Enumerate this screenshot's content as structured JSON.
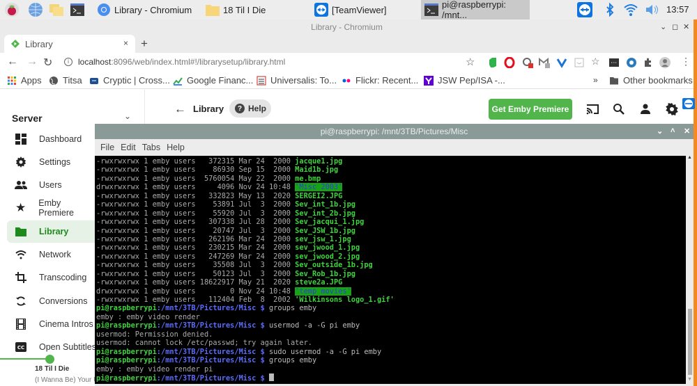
{
  "taskbar": {
    "tasks": [
      {
        "label": "Library - Chromium",
        "icon": "chromium-icon"
      },
      {
        "label": "18 Til I Die",
        "icon": "folder-icon"
      },
      {
        "label": "[TeamViewer]",
        "icon": "teamviewer-icon"
      },
      {
        "label": "pi@raspberrypi: /mnt...",
        "icon": "terminal-icon",
        "active": true
      }
    ],
    "launchers": [
      "raspberry-menu-icon",
      "web-browser-icon",
      "file-manager-icon",
      "terminal-icon"
    ],
    "tray": [
      "teamviewer-icon",
      "bluetooth-icon",
      "wifi-icon",
      "volume-icon"
    ],
    "clock": "13:57"
  },
  "browser": {
    "window_title": "Library - Chromium",
    "tab": {
      "label": "Library",
      "close": "×"
    },
    "new_tab": "+",
    "url_host": "localhost",
    "url_rest": ":8096/web/index.html#!/librarysetup/library.html",
    "bookmarks": [
      {
        "label": "Apps"
      },
      {
        "label": "Titsa"
      },
      {
        "label": "Cryptic | Cross..."
      },
      {
        "label": "Google Financ..."
      },
      {
        "label": "Universalis: To..."
      },
      {
        "label": "Flickr: Recent..."
      },
      {
        "label": "JSW Pep/ISA -..."
      }
    ],
    "bookmarks_overflow": "»",
    "other_bookmarks": "Other bookmarks"
  },
  "emby": {
    "section": "Server",
    "sidebar": [
      {
        "label": "Dashboard",
        "icon": "dashboard-icon"
      },
      {
        "label": "Settings",
        "icon": "gear-icon"
      },
      {
        "label": "Users",
        "icon": "users-icon"
      },
      {
        "label": "Emby Premiere",
        "icon": "star-icon"
      },
      {
        "label": "Library",
        "icon": "folder-icon",
        "active": true
      },
      {
        "label": "Network",
        "icon": "wifi-icon"
      },
      {
        "label": "Transcoding",
        "icon": "crop-icon"
      },
      {
        "label": "Conversions",
        "icon": "sync-icon"
      },
      {
        "label": "Cinema Intros",
        "icon": "film-icon"
      },
      {
        "label": "Open Subtitles",
        "icon": "cc-icon"
      }
    ],
    "page_title": "Library",
    "help_label": "Help",
    "premiere_button": "Get Emby Premiere",
    "accent": "#52b54b",
    "now_playing": {
      "title": "18 Til I Die",
      "artist": "(I Wanna Be) Your Underwear"
    }
  },
  "terminal": {
    "title": "pi@raspberrypi: /mnt/3TB/Pictures/Misc",
    "menu": [
      "File",
      "Edit",
      "Tabs",
      "Help"
    ],
    "listing": [
      {
        "perms": "-rwxrwxrwx 1 emby users   372315 Mar 24  2000 ",
        "name": "jacque1.jpg",
        "dir": false
      },
      {
        "perms": "-rwxrwxrwx 1 emby users    86930 Sep 15  2000 ",
        "name": "Maid1b.jpg",
        "dir": false
      },
      {
        "perms": "-rwxrwxrwx 1 emby users  5760054 May 22  2000 ",
        "name": "me.bmp",
        "dir": false
      },
      {
        "perms": "drwxrwxrwx 1 emby users     4096 Nov 24 10:48 ",
        "name": "'Misc 2003'",
        "dir": true
      },
      {
        "perms": "-rwxrwxrwx 1 emby users   332823 May 13  2020 ",
        "name": "SERGEI2.JPG",
        "dir": false
      },
      {
        "perms": "-rwxrwxrwx 1 emby users    53891 Jul  3  2000 ",
        "name": "Sev_int_1b.jpg",
        "dir": false
      },
      {
        "perms": "-rwxrwxrwx 1 emby users    55920 Jul  3  2000 ",
        "name": "Sev_int_2b.jpg",
        "dir": false
      },
      {
        "perms": "-rwxrwxrwx 1 emby users   307338 Jul 28  2000 ",
        "name": "Sev_jacqui_1.jpg",
        "dir": false
      },
      {
        "perms": "-rwxrwxrwx 1 emby users    20747 Jul  3  2000 ",
        "name": "Sev_JSW_1b.jpg",
        "dir": false
      },
      {
        "perms": "-rwxrwxrwx 1 emby users   262196 Mar 24  2000 ",
        "name": "sev_jsw_1.jpg",
        "dir": false
      },
      {
        "perms": "-rwxrwxrwx 1 emby users   230215 Mar 24  2000 ",
        "name": "sev_jwood_1.jpg",
        "dir": false
      },
      {
        "perms": "-rwxrwxrwx 1 emby users   247269 Mar 24  2000 ",
        "name": "sev_jwood_2.jpg",
        "dir": false
      },
      {
        "perms": "-rwxrwxrwx 1 emby users    35508 Jul  3  2000 ",
        "name": "Sev_outside_1b.jpg",
        "dir": false
      },
      {
        "perms": "-rwxrwxrwx 1 emby users    50123 Jul  3  2000 ",
        "name": "Sev_Rob_1b.jpg",
        "dir": false
      },
      {
        "perms": "-rwxrwxrwx 1 emby users 18622917 May 21  2020 ",
        "name": "steve2a.JPG",
        "dir": false
      },
      {
        "perms": "drwxrwxrwx 1 emby users        0 Nov 24 10:48 ",
        "name": "'temp movies'",
        "dir": true
      },
      {
        "perms": "-rwxrwxrwx 1 emby users   112404 Feb  8  2002 ",
        "name": "'Wilkinsons logo_1.gif'",
        "dir": false
      }
    ],
    "prompt_user": "pi@raspberrypi",
    "prompt_path": ":/mnt/3TB/Pictures/Misc $ ",
    "session": [
      {
        "type": "cmd",
        "text": "groups emby"
      },
      {
        "type": "out",
        "text": "emby : emby video render"
      },
      {
        "type": "cmd",
        "text": "usermod -a -G pi emby"
      },
      {
        "type": "out",
        "text": "usermod: Permission denied."
      },
      {
        "type": "out",
        "text": "usermod: cannot lock /etc/passwd; try again later."
      },
      {
        "type": "cmd",
        "text": "sudo usermod -a -G pi emby"
      },
      {
        "type": "cmd",
        "text": "groups emby"
      },
      {
        "type": "out",
        "text": "emby : emby video render pi"
      },
      {
        "type": "cmd",
        "text": ""
      }
    ]
  }
}
